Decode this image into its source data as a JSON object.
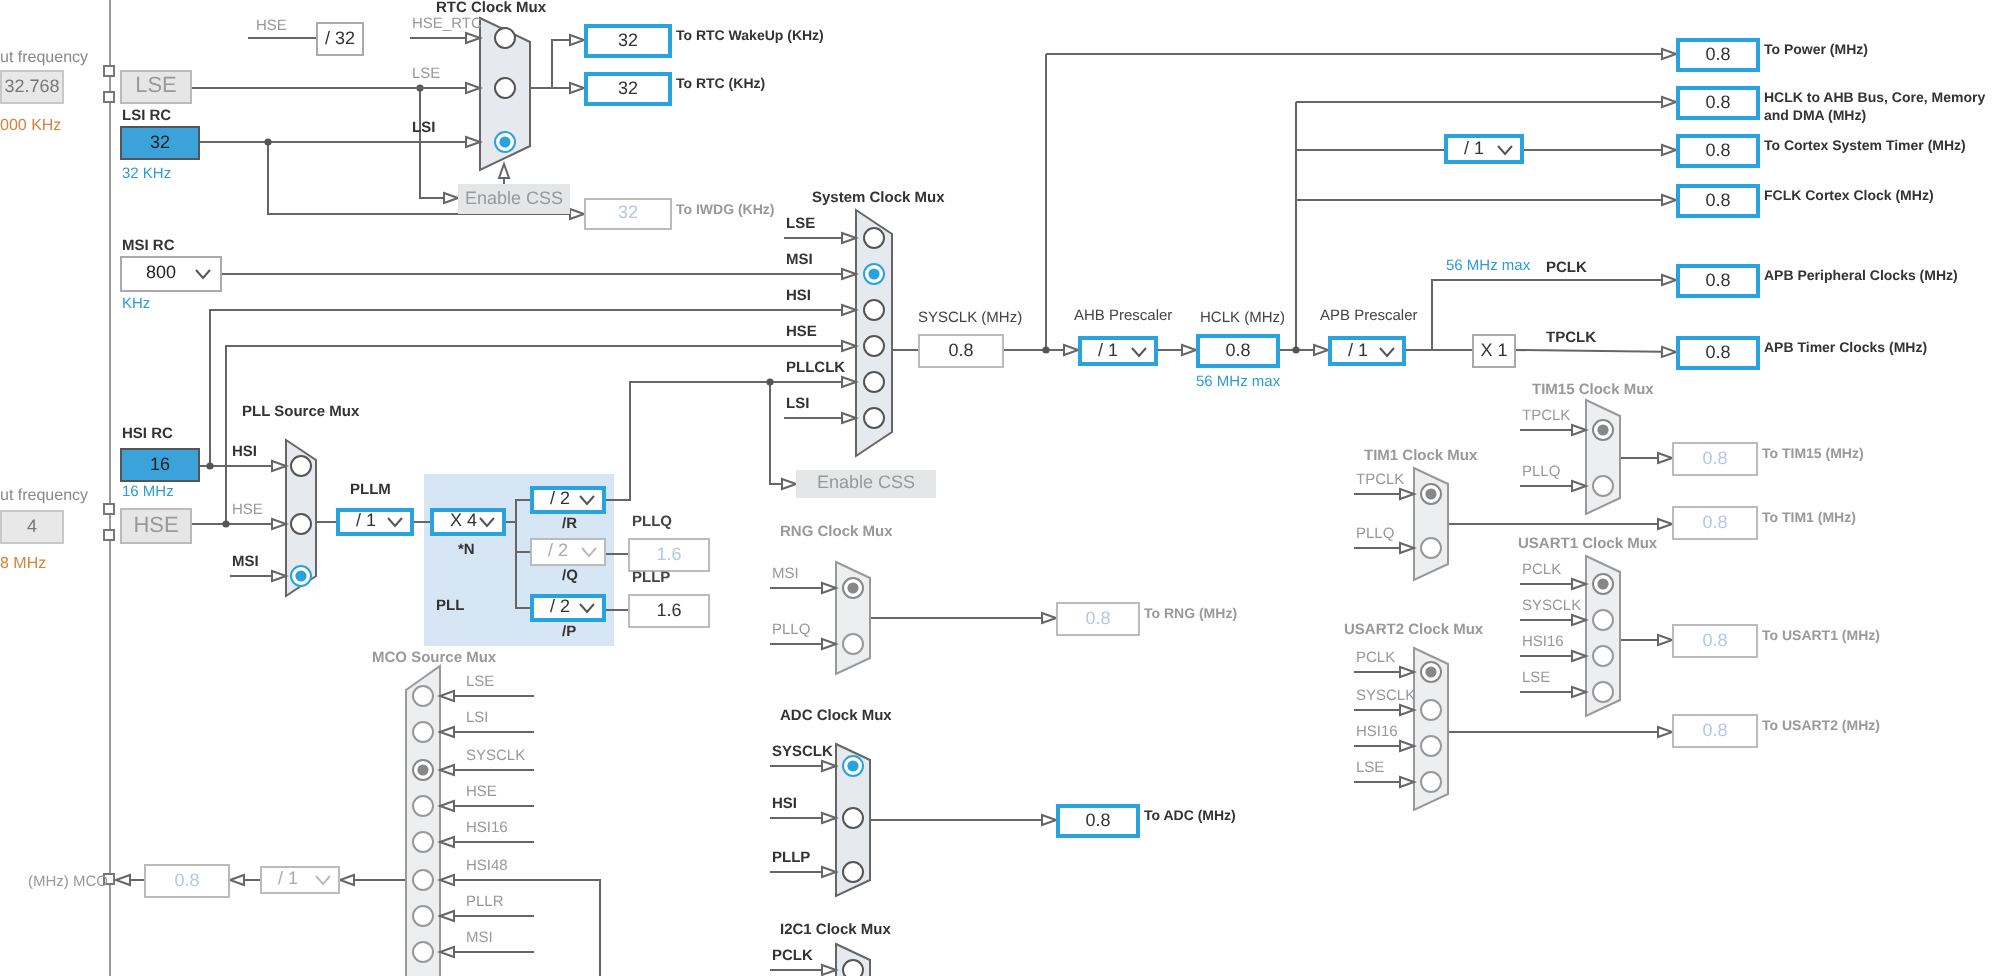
{
  "input_frequencies": [
    {
      "label": "ut frequency",
      "value": "32.768",
      "range": "000 KHz"
    },
    {
      "label": "ut frequency",
      "value": "4",
      "range": "8 MHz"
    }
  ],
  "oscillators": [
    {
      "kind": "external",
      "name": "LSE"
    },
    {
      "kind": "rc",
      "name": "LSI RC",
      "value": "32",
      "unit": "32 KHz"
    },
    {
      "kind": "rc_select",
      "name": "MSI RC",
      "value": "800",
      "unit": "KHz"
    },
    {
      "kind": "rc",
      "name": "HSI RC",
      "value": "16",
      "unit": "16 MHz"
    },
    {
      "kind": "external",
      "name": "HSE"
    }
  ],
  "muxes": [
    {
      "title": "RTC Clock Mux",
      "enabled": true,
      "inputs": [
        {
          "label": "HSE_RTC",
          "active": false,
          "selected": false
        },
        {
          "label": "LSE",
          "active": false,
          "selected": false
        },
        {
          "label": "LSI",
          "active": true,
          "selected": true
        }
      ]
    },
    {
      "title": "System Clock Mux",
      "enabled": true,
      "inputs": [
        {
          "label": "LSE",
          "active": true,
          "selected": false
        },
        {
          "label": "MSI",
          "active": true,
          "selected": true
        },
        {
          "label": "HSI",
          "active": true,
          "selected": false
        },
        {
          "label": "HSE",
          "active": true,
          "selected": false
        },
        {
          "label": "PLLCLK",
          "active": true,
          "selected": false
        },
        {
          "label": "LSI",
          "active": true,
          "selected": false
        }
      ]
    },
    {
      "title": "PLL Source Mux",
      "enabled": true,
      "inputs": [
        {
          "label": "HSI",
          "active": true,
          "selected": false
        },
        {
          "label": "HSE",
          "active": false,
          "selected": false
        },
        {
          "label": "MSI",
          "active": true,
          "selected": true
        }
      ]
    },
    {
      "title": "RNG Clock Mux",
      "enabled": false,
      "inputs": [
        {
          "label": "MSI",
          "active": false,
          "selected": true
        },
        {
          "label": "PLLQ",
          "active": false,
          "selected": false
        }
      ]
    },
    {
      "title": "ADC Clock Mux",
      "enabled": true,
      "inputs": [
        {
          "label": "SYSCLK",
          "active": true,
          "selected": true
        },
        {
          "label": "HSI",
          "active": true,
          "selected": false
        },
        {
          "label": "PLLP",
          "active": true,
          "selected": false
        }
      ]
    },
    {
      "title": "I2C1 Clock Mux",
      "enabled": true,
      "inputs": [
        {
          "label": "PCLK",
          "active": true,
          "selected": false
        }
      ]
    },
    {
      "title": "MCO Source Mux",
      "enabled": false,
      "inputs": [
        {
          "label": "LSE",
          "active": false,
          "selected": false
        },
        {
          "label": "LSI",
          "active": false,
          "selected": false
        },
        {
          "label": "SYSCLK",
          "active": false,
          "selected": true
        },
        {
          "label": "HSE",
          "active": false,
          "selected": false
        },
        {
          "label": "HSI16",
          "active": false,
          "selected": false
        },
        {
          "label": "HSI48",
          "active": false,
          "selected": false
        },
        {
          "label": "PLLR",
          "active": false,
          "selected": false
        },
        {
          "label": "MSI",
          "active": false,
          "selected": false
        }
      ]
    },
    {
      "title": "TIM15 Clock Mux",
      "enabled": false,
      "inputs": [
        {
          "label": "TPCLK",
          "active": false,
          "selected": true
        },
        {
          "label": "PLLQ",
          "active": false,
          "selected": false
        }
      ]
    },
    {
      "title": "TIM1 Clock Mux",
      "enabled": false,
      "inputs": [
        {
          "label": "TPCLK",
          "active": false,
          "selected": true
        },
        {
          "label": "PLLQ",
          "active": false,
          "selected": false
        }
      ]
    },
    {
      "title": "USART1 Clock Mux",
      "enabled": false,
      "inputs": [
        {
          "label": "PCLK",
          "active": false,
          "selected": true
        },
        {
          "label": "SYSCLK",
          "active": false,
          "selected": false
        },
        {
          "label": "HSI16",
          "active": false,
          "selected": false
        },
        {
          "label": "LSE",
          "active": false,
          "selected": false
        }
      ]
    },
    {
      "title": "USART2 Clock Mux",
      "enabled": false,
      "inputs": [
        {
          "label": "PCLK",
          "active": false,
          "selected": true
        },
        {
          "label": "SYSCLK",
          "active": false,
          "selected": false
        },
        {
          "label": "HSI16",
          "active": false,
          "selected": false
        },
        {
          "label": "LSE",
          "active": false,
          "selected": false
        }
      ]
    }
  ],
  "prescalers": [
    {
      "kind": "fixed",
      "value": "/ 32",
      "enabled": true
    },
    {
      "kind": "select",
      "value": "/ 1",
      "label": "AHB Prescaler",
      "enabled": true
    },
    {
      "kind": "select",
      "value": "/ 1",
      "enabled": true
    },
    {
      "kind": "select",
      "value": "/ 1",
      "label": "APB Prescaler",
      "enabled": true
    },
    {
      "kind": "fixed",
      "value": "X 1",
      "enabled": true
    },
    {
      "kind": "select",
      "value": "/ 1",
      "label": "PLLM",
      "enabled": true
    },
    {
      "kind": "select",
      "value": "X 4",
      "label": "*N",
      "enabled": true
    },
    {
      "kind": "select",
      "value": "/ 2",
      "label": "/R",
      "enabled": true
    },
    {
      "kind": "select",
      "value": "/ 2",
      "label": "/Q",
      "enabled": false
    },
    {
      "kind": "select",
      "value": "/ 2",
      "label": "/P",
      "enabled": true
    },
    {
      "kind": "select",
      "value": "/ 1",
      "enabled": false
    }
  ],
  "pll": {
    "label": "PLL"
  },
  "outputs": [
    {
      "kind": "right",
      "value": "32",
      "label": "To RTC WakeUp (KHz)",
      "editable": true,
      "enabled": true
    },
    {
      "kind": "right",
      "value": "32",
      "label": "To RTC (KHz)",
      "editable": true,
      "enabled": true
    },
    {
      "kind": "right",
      "value": "32",
      "label": "To IWDG (KHz)",
      "editable": false,
      "enabled": false
    },
    {
      "kind": "above",
      "value": "0.8",
      "label": "SYSCLK (MHz)",
      "editable": false,
      "enabled": true
    },
    {
      "kind": "above",
      "value": "0.8",
      "label": "HCLK (MHz)",
      "note": "56 MHz max",
      "editable": true,
      "enabled": true
    },
    {
      "kind": "right",
      "value": "0.8",
      "label": "To Power (MHz)",
      "editable": true,
      "enabled": true
    },
    {
      "kind": "right",
      "value": "0.8",
      "label": "HCLK to AHB Bus, Core, Memory and DMA (MHz)",
      "editable": true,
      "enabled": true
    },
    {
      "kind": "right",
      "value": "0.8",
      "label": "To Cortex System Timer (MHz)",
      "editable": true,
      "enabled": true
    },
    {
      "kind": "right",
      "value": "0.8",
      "label": "FCLK Cortex Clock (MHz)",
      "editable": true,
      "enabled": true
    },
    {
      "kind": "right",
      "value": "0.8",
      "label": "APB Peripheral Clocks (MHz)",
      "editable": true,
      "enabled": true
    },
    {
      "kind": "right",
      "value": "0.8",
      "label": "APB Timer Clocks (MHz)",
      "editable": true,
      "enabled": true
    },
    {
      "kind": "above",
      "value": "1.6",
      "label": "PLLQ",
      "editable": false,
      "enabled": false
    },
    {
      "kind": "above",
      "value": "1.6",
      "label": "PLLP",
      "editable": false,
      "enabled": true
    },
    {
      "kind": "right",
      "value": "0.8",
      "label": "To RNG (MHz)",
      "editable": false,
      "enabled": false
    },
    {
      "kind": "right",
      "value": "0.8",
      "label": "To ADC (MHz)",
      "editable": true,
      "enabled": true
    },
    {
      "kind": "right",
      "value": "0.8",
      "label": "To TIM15 (MHz)",
      "editable": false,
      "enabled": false
    },
    {
      "kind": "right",
      "value": "0.8",
      "label": "To TIM1 (MHz)",
      "editable": false,
      "enabled": false
    },
    {
      "kind": "right",
      "value": "0.8",
      "label": "To USART1 (MHz)",
      "editable": false,
      "enabled": false
    },
    {
      "kind": "right",
      "value": "0.8",
      "label": "To USART2 (MHz)",
      "editable": false,
      "enabled": false
    },
    {
      "kind": "left",
      "value": "0.8",
      "label": "(MHz) MCO",
      "editable": false,
      "enabled": false
    }
  ],
  "css_buttons": [
    {
      "label": "Enable CSS",
      "enabled": false
    },
    {
      "label": "Enable CSS",
      "enabled": false
    }
  ],
  "signal_labels": [
    {
      "kind": "inactive",
      "text": "HSE"
    },
    {
      "kind": "limit",
      "text": "56 MHz max"
    },
    {
      "kind": "signal",
      "text": "PCLK"
    },
    {
      "kind": "signal",
      "text": "TPCLK"
    }
  ]
}
